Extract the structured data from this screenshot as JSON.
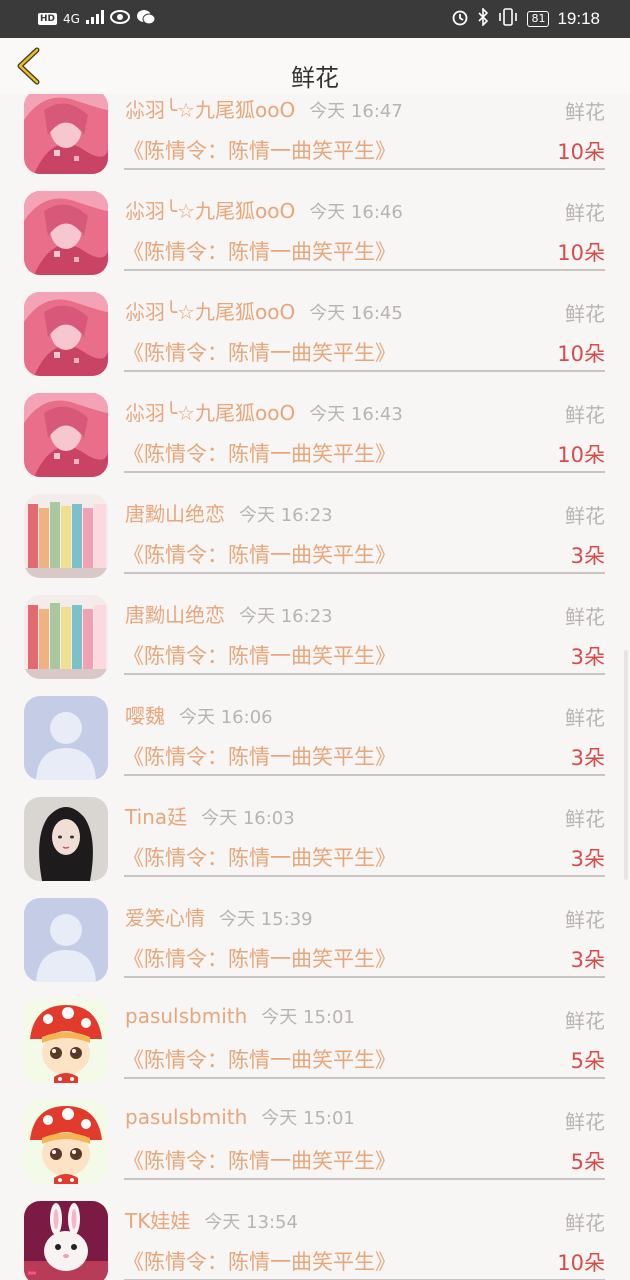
{
  "status_bar": {
    "hd": "HD",
    "network": "4G",
    "battery": "81",
    "time": "19:18"
  },
  "header": {
    "title": "鲜花"
  },
  "gifts": [
    {
      "name": "尛羽╰☆九尾狐ooO",
      "time": "今天 16:47",
      "type": "鲜花",
      "book": "《陈情令：陈情一曲笑平生》",
      "count": "10朵",
      "avatar": "pink-anime-avatar"
    },
    {
      "name": "尛羽╰☆九尾狐ooO",
      "time": "今天 16:46",
      "type": "鲜花",
      "book": "《陈情令：陈情一曲笑平生》",
      "count": "10朵",
      "avatar": "pink-anime-avatar"
    },
    {
      "name": "尛羽╰☆九尾狐ooO",
      "time": "今天 16:45",
      "type": "鲜花",
      "book": "《陈情令：陈情一曲笑平生》",
      "count": "10朵",
      "avatar": "pink-anime-avatar"
    },
    {
      "name": "尛羽╰☆九尾狐ooO",
      "time": "今天 16:43",
      "type": "鲜花",
      "book": "《陈情令：陈情一曲笑平生》",
      "count": "10朵",
      "avatar": "pink-anime-avatar"
    },
    {
      "name": "唐黝山绝恋",
      "time": "今天 16:23",
      "type": "鲜花",
      "book": "《陈情令：陈情一曲笑平生》",
      "count": "3朵",
      "avatar": "books-avatar"
    },
    {
      "name": "唐黝山绝恋",
      "time": "今天 16:23",
      "type": "鲜花",
      "book": "《陈情令：陈情一曲笑平生》",
      "count": "3朵",
      "avatar": "books-avatar"
    },
    {
      "name": "嘤魏",
      "time": "今天 16:06",
      "type": "鲜花",
      "book": "《陈情令：陈情一曲笑平生》",
      "count": "3朵",
      "avatar": "default-user-avatar"
    },
    {
      "name": "Tina廷",
      "time": "今天 16:03",
      "type": "鲜花",
      "book": "《陈情令：陈情一曲笑平生》",
      "count": "3朵",
      "avatar": "girl-photo-avatar"
    },
    {
      "name": "爱笑心情",
      "time": "今天 15:39",
      "type": "鲜花",
      "book": "《陈情令：陈情一曲笑平生》",
      "count": "3朵",
      "avatar": "default-user-avatar"
    },
    {
      "name": "pasulsbmith",
      "time": "今天 15:01",
      "type": "鲜花",
      "book": "《陈情令：陈情一曲笑平生》",
      "count": "5朵",
      "avatar": "mushroom-girl-avatar"
    },
    {
      "name": "pasulsbmith",
      "time": "今天 15:01",
      "type": "鲜花",
      "book": "《陈情令：陈情一曲笑平生》",
      "count": "5朵",
      "avatar": "mushroom-girl-avatar"
    },
    {
      "name": "TK娃娃",
      "time": "今天 13:54",
      "type": "鲜花",
      "book": "《陈情令：陈情一曲笑平生》",
      "count": "10朵",
      "avatar": "rabbit-avatar"
    }
  ],
  "colors": {
    "accent": "#e6a77c",
    "count": "#d94b4b",
    "muted": "#b9b4b3",
    "statusbar": "#3a3a3a",
    "back_arrow": "#f0c020"
  }
}
